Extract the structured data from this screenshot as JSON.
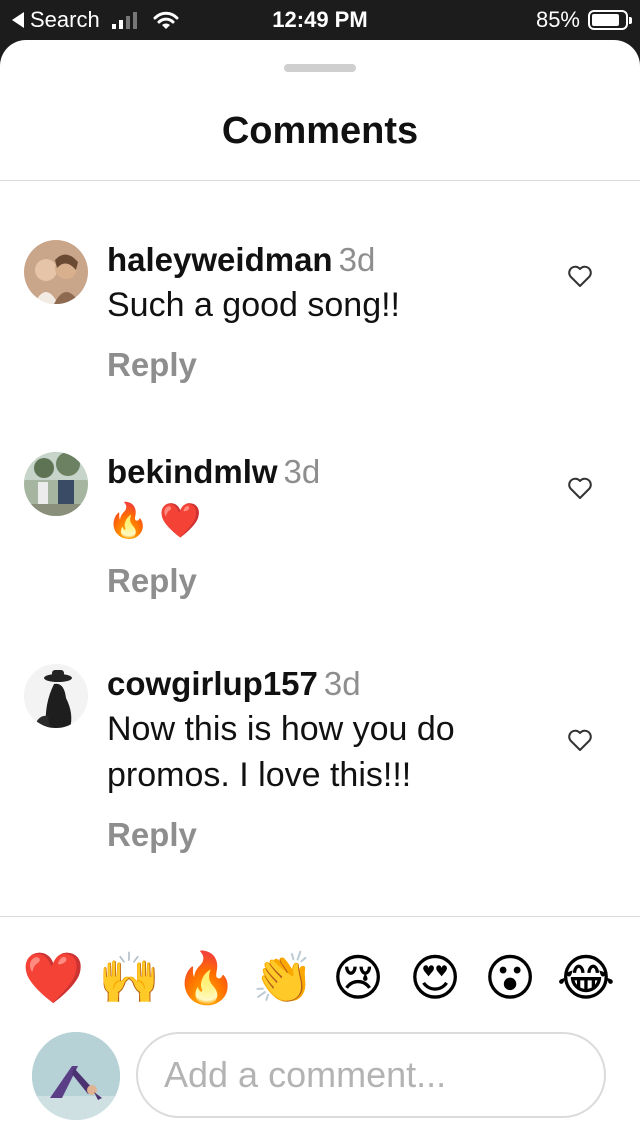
{
  "status_bar": {
    "back_label": "Search",
    "time": "12:49 PM",
    "battery_percent": "85%",
    "battery_level": 0.85,
    "signal_bars_active": 2,
    "signal_bars_total": 4,
    "icons": [
      "back-arrow-icon",
      "cellular-signal-icon",
      "wifi-icon",
      "battery-icon"
    ]
  },
  "sheet": {
    "title": "Comments"
  },
  "comments": [
    {
      "username": "haleyweidman",
      "time_ago": "3d",
      "text": "Such a good song!!",
      "emoji": [],
      "reply_label": "Reply",
      "avatar_icon": "user-avatar"
    },
    {
      "username": "bekindmlw",
      "time_ago": "3d",
      "text": "",
      "emoji": [
        "🔥",
        "❤️"
      ],
      "reply_label": "Reply",
      "avatar_icon": "user-avatar"
    },
    {
      "username": "cowgirlup157",
      "time_ago": "3d",
      "text": "Now this is how you do promos. I love this!!!",
      "emoji": [],
      "reply_label": "Reply",
      "avatar_icon": "user-avatar"
    }
  ],
  "quick_reactions": [
    "❤️",
    "🙌",
    "🔥",
    "👏",
    "😢",
    "😍",
    "😮",
    "😂"
  ],
  "composer": {
    "placeholder": "Add a comment...",
    "value": ""
  },
  "colors": {
    "status_bar_bg": "#1c1c1c",
    "secondary_text": "#8e8e8e",
    "divider": "#dbdbdb"
  }
}
